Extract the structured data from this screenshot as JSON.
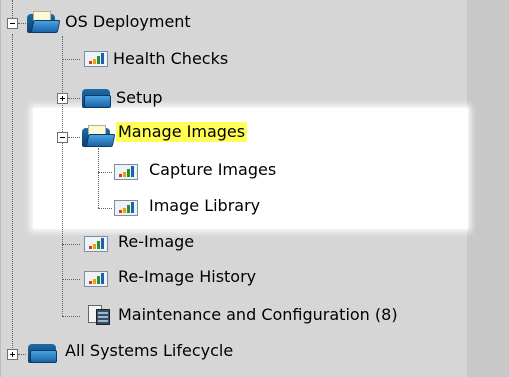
{
  "tree": {
    "items": [
      {
        "label": "OS Deployment",
        "icon": "folder-open-icon",
        "expanded": true
      },
      {
        "label": "Health Checks",
        "icon": "report-chart-icon"
      },
      {
        "label": "Setup",
        "icon": "folder-icon",
        "expanded": false
      },
      {
        "label": "Manage Images",
        "icon": "folder-open-icon",
        "expanded": true,
        "selected": true
      },
      {
        "label": "Capture Images",
        "icon": "report-chart-icon"
      },
      {
        "label": "Image Library",
        "icon": "report-chart-icon"
      },
      {
        "label": "Re-Image",
        "icon": "report-chart-icon"
      },
      {
        "label": "Re-Image History",
        "icon": "report-chart-icon"
      },
      {
        "label": "Maintenance and Configuration (8)",
        "icon": "maintenance-icon"
      },
      {
        "label": "All Systems Lifecycle",
        "icon": "folder-icon",
        "expanded": false
      }
    ]
  },
  "colors": {
    "selection_highlight": "#ffff55",
    "panel_background": "#d6d6d6",
    "focus_background": "#ffffff"
  }
}
